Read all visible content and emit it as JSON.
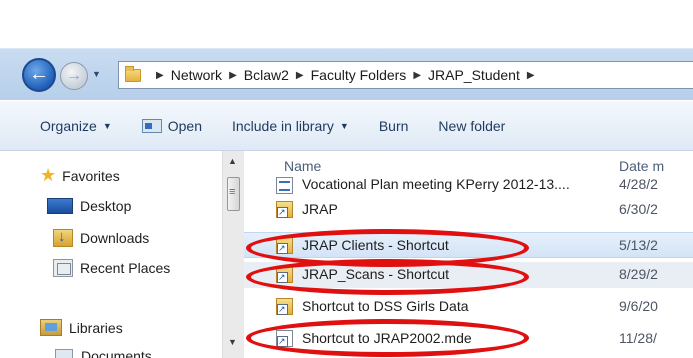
{
  "address": {
    "breadcrumbs": [
      "Network",
      "Bclaw2",
      "Faculty Folders",
      "JRAP_Student"
    ]
  },
  "toolbar": {
    "organize_label": "Organize",
    "open_label": "Open",
    "include_label": "Include in library",
    "burn_label": "Burn",
    "new_folder_label": "New folder"
  },
  "navigation": {
    "favorites_label": "Favorites",
    "desktop_label": "Desktop",
    "downloads_label": "Downloads",
    "recent_label": "Recent Places",
    "libraries_label": "Libraries",
    "documents_label": "Documents"
  },
  "columns": {
    "name_label": "Name",
    "date_label": "Date m"
  },
  "files": [
    {
      "name": "Vocational Plan meeting KPerry 2012-13....",
      "date": "4/28/2",
      "icon": "document-icon"
    },
    {
      "name": "JRAP",
      "date": "6/30/2",
      "icon": "folder-shortcut-icon"
    },
    {
      "name": "JRAP Clients - Shortcut",
      "date": "5/13/2",
      "icon": "shortcut-icon"
    },
    {
      "name": "JRAP_Scans - Shortcut",
      "date": "8/29/2",
      "icon": "shortcut-icon"
    },
    {
      "name": "Shortcut to DSS Girls Data",
      "date": "9/6/20",
      "icon": "folder-shortcut-icon"
    },
    {
      "name": "Shortcut to JRAP2002.mde",
      "date": "11/28/",
      "icon": "shortcut-icon"
    }
  ],
  "colors": {
    "annotation_red": "#e01010",
    "selection_blue": "#d3e4f7",
    "address_bar": "#c9dcf1"
  }
}
